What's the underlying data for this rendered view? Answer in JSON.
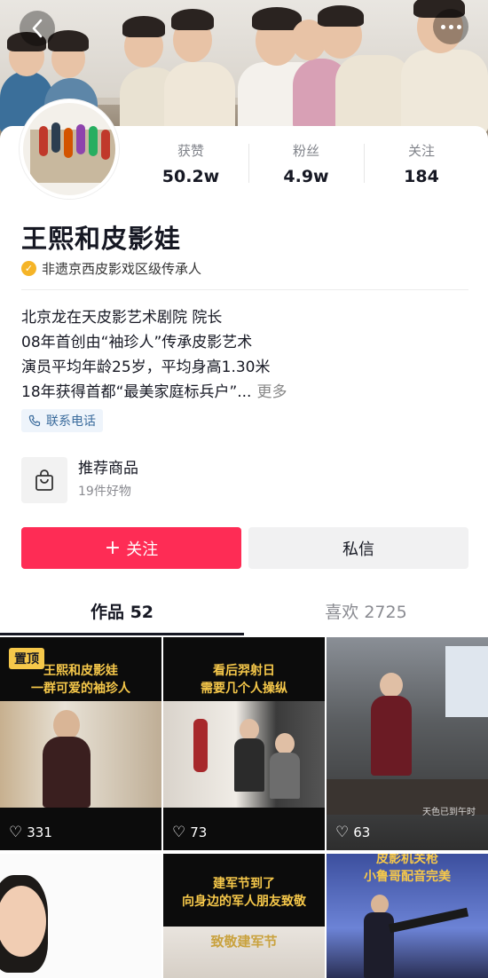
{
  "header": {
    "back_icon": "chevron-left-icon",
    "more_icon": "more-dots-icon"
  },
  "profile": {
    "name": "王熙和皮影娃",
    "verification": "非遗京西皮影戏区级传承人",
    "stats": [
      {
        "label": "获赞",
        "value": "50.2w"
      },
      {
        "label": "粉丝",
        "value": "4.9w"
      },
      {
        "label": "关注",
        "value": "184"
      }
    ],
    "bio_lines": [
      "北京龙在天皮影艺术剧院 院长",
      "08年首创由“袖珍人”传承皮影艺术",
      "演员平均年龄25岁，平均身高1.30米",
      "18年获得首都“最美家庭标兵户”..."
    ],
    "bio_more": "更多",
    "contact_label": "联系电话"
  },
  "shop": {
    "title": "推荐商品",
    "subtitle": "19件好物"
  },
  "actions": {
    "follow_label": "关注",
    "message_label": "私信"
  },
  "tabs": [
    {
      "label": "作品 52",
      "active": true
    },
    {
      "label": "喜欢 2725",
      "active": false
    }
  ],
  "videos": [
    {
      "pinned": "置顶",
      "caption_line1": "王熙和皮影娃",
      "caption_line2": "一群可爱的袖珍人",
      "likes": "331"
    },
    {
      "caption_line1": "看后羿射日",
      "caption_line2": "需要几个人操纵",
      "likes": "73"
    },
    {
      "caption_line1": "",
      "caption_line2": "",
      "likes": "63",
      "watermark": "天色已到午时"
    },
    {
      "caption_line1": "",
      "caption_line2": "",
      "likes": ""
    },
    {
      "caption_line1": "建军节到了",
      "caption_line2": "向身边的军人朋友致敬",
      "caption_line3": "致敬建军节",
      "likes": ""
    },
    {
      "caption_line1": "皮影机关枪",
      "caption_line2": "小鲁哥配音完美",
      "likes": ""
    }
  ],
  "colors": {
    "accent": "#fe2c55",
    "caption": "#f6c84a",
    "verify": "#f5b427"
  }
}
